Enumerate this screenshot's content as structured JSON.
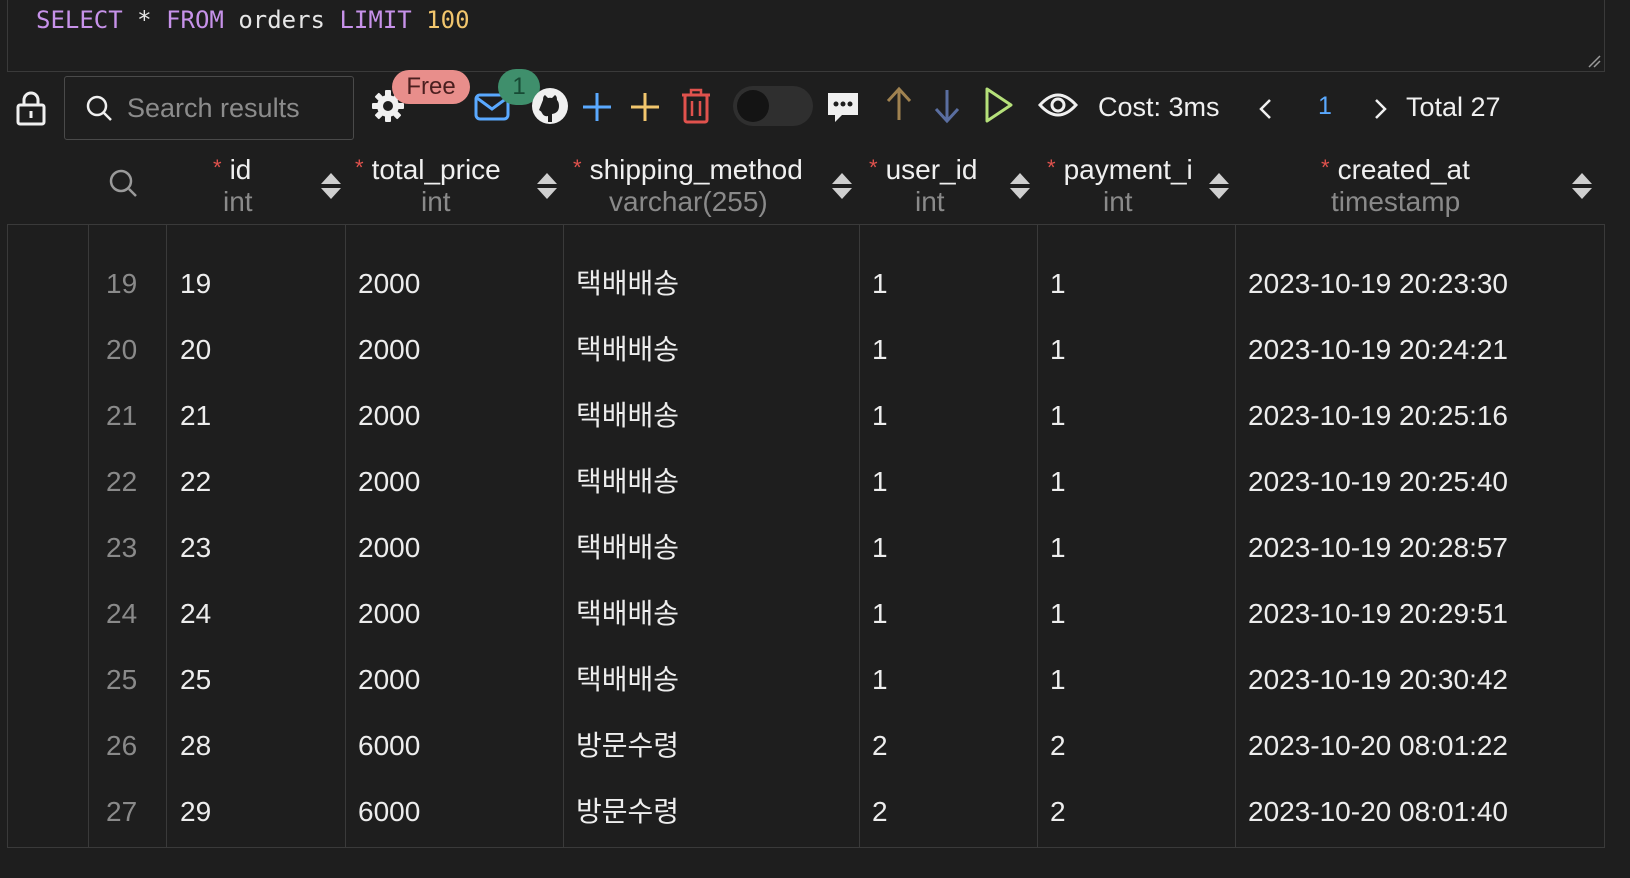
{
  "editor": {
    "sql_select": "SELECT",
    "sql_star": "*",
    "sql_from": "FROM",
    "sql_table": "orders",
    "sql_limit": "LIMIT",
    "sql_limit_value": "100"
  },
  "toolbar": {
    "search_placeholder": "Search results",
    "free_badge": "Free",
    "mail_count": "1",
    "cost_label": "Cost: 3ms",
    "page": "1",
    "total_label": "Total 27",
    "icons": [
      "lock-icon",
      "search-icon",
      "gear-icon",
      "mail-icon",
      "github-icon",
      "add-row-icon",
      "insert-icon",
      "delete-icon",
      "toggle",
      "comment-icon",
      "arrow-up-icon",
      "arrow-down-icon",
      "run-icon",
      "eye-icon",
      "chevron-left-icon",
      "chevron-right-icon"
    ]
  },
  "columns": [
    {
      "name": "id",
      "type": "int"
    },
    {
      "name": "total_price",
      "type": "int"
    },
    {
      "name": "shipping_method",
      "type": "varchar(255)"
    },
    {
      "name": "user_id",
      "type": "int"
    },
    {
      "name": "payment_i",
      "type": "int"
    },
    {
      "name": "created_at",
      "type": "timestamp"
    }
  ],
  "rows": [
    {
      "n": "19",
      "cells": [
        "19",
        "2000",
        "택배배송",
        "1",
        "1",
        "2023-10-19 20:23:30"
      ]
    },
    {
      "n": "20",
      "cells": [
        "20",
        "2000",
        "택배배송",
        "1",
        "1",
        "2023-10-19 20:24:21"
      ]
    },
    {
      "n": "21",
      "cells": [
        "21",
        "2000",
        "택배배송",
        "1",
        "1",
        "2023-10-19 20:25:16"
      ]
    },
    {
      "n": "22",
      "cells": [
        "22",
        "2000",
        "택배배송",
        "1",
        "1",
        "2023-10-19 20:25:40"
      ]
    },
    {
      "n": "23",
      "cells": [
        "23",
        "2000",
        "택배배송",
        "1",
        "1",
        "2023-10-19 20:28:57"
      ]
    },
    {
      "n": "24",
      "cells": [
        "24",
        "2000",
        "택배배송",
        "1",
        "1",
        "2023-10-19 20:29:51"
      ]
    },
    {
      "n": "25",
      "cells": [
        "25",
        "2000",
        "택배배송",
        "1",
        "1",
        "2023-10-19 20:30:42"
      ]
    },
    {
      "n": "26",
      "cells": [
        "28",
        "6000",
        "방문수령",
        "2",
        "2",
        "2023-10-20 08:01:22"
      ]
    },
    {
      "n": "27",
      "cells": [
        "29",
        "6000",
        "방문수령",
        "2",
        "2",
        "2023-10-20 08:01:40"
      ]
    }
  ],
  "colors": {
    "keyword": "#c792ea",
    "number": "#f2c66d",
    "required": "#e0524d",
    "badge_free": "#e88e8b",
    "badge_count": "#3f8f6c",
    "accent_blue": "#5aa9ff"
  }
}
